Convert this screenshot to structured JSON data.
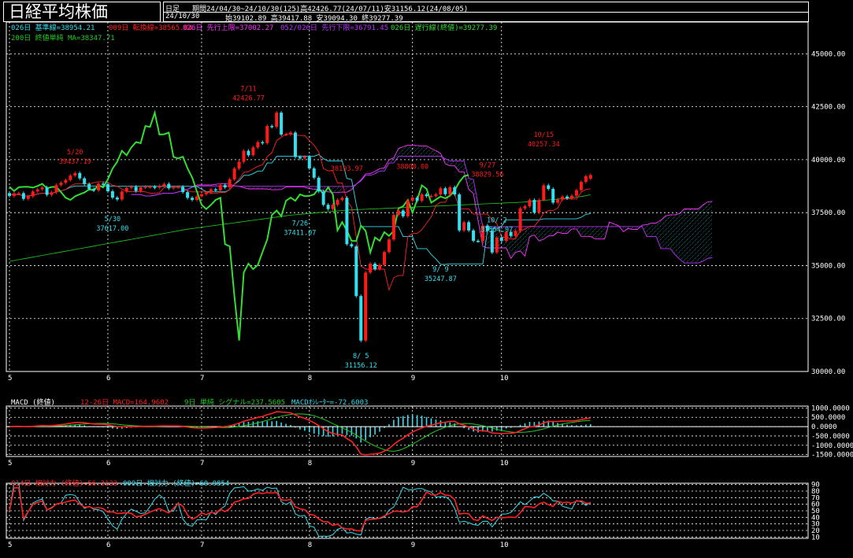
{
  "title": "日経平均株価",
  "header": {
    "period_type": "日足",
    "period_text": "期間24/04/30~24/10/30(125)高42426.77(24/07/11)安31156.12(24/08/05)",
    "date": "24/10/30",
    "ohlc": "始39102.89 高39417.88 安39094.30 終39277.39"
  },
  "colors": {
    "bg": "#000000",
    "grid": "#ffffff",
    "up": "#ff1a1a",
    "down": "#33e0f0",
    "ma200": "#22cc22",
    "chikou": "#33dd33",
    "kijun": "#33ddee",
    "tenkan": "#ff2222",
    "spanA": "#ff33ff",
    "spanB": "#bb33ff",
    "macd": "#ff2222",
    "signal": "#22cc22",
    "hist": "#33ddee",
    "rsi14": "#ff2222",
    "rsi9": "#33ddee"
  },
  "months": [
    "5",
    "6",
    "7",
    "8",
    "9",
    "10"
  ],
  "legend_main": {
    "kijun": "026日 基準線=38954.21",
    "tenkan": "009日 転換線=38565.04",
    "span_a": "026日 先行上限=37002.27",
    "span_b": "052/026日 先行下限=36791.45",
    "chikou": "026日 遅行線(終値)=39277.39",
    "ma200": "200日 終値単純 MA=38347.71"
  },
  "legend_macd": {
    "name": "MACD (終値)",
    "macd": "12-26日 MACD=164.9602",
    "signal": "9日 単純 シグナル=237.5605",
    "osc": "MACDｵｼﾚｰﾀｰ=-72.6003"
  },
  "legend_rsi": {
    "rsi14": "014日 相対力 (終値)=56.3133",
    "rsi9": "009日 相対力 (終値)=60.0854"
  },
  "annotations": [
    {
      "date_label": "5/20",
      "value_label": "39437.19",
      "color": "up"
    },
    {
      "date_label": "5/30",
      "value_label": "37617.00",
      "color": "down"
    },
    {
      "date_label": "7/11",
      "value_label": "42426.77",
      "color": "up"
    },
    {
      "date_label": "7/26",
      "value_label": "37411.07",
      "color": "down"
    },
    {
      "date_label": "8/ 5",
      "value_label": "31156.12",
      "color": "down"
    },
    {
      "date_label": "",
      "value_label": "38193.97",
      "color": "up"
    },
    {
      "date_label": "",
      "value_label": "38800.00",
      "color": "up"
    },
    {
      "date_label": "9/ 9",
      "value_label": "35247.87",
      "color": "down"
    },
    {
      "date_label": "9/27",
      "value_label": "38829.56",
      "color": "up"
    },
    {
      "date_label": "10/ 2",
      "value_label": "37564.97",
      "color": "down"
    },
    {
      "date_label": "10/15",
      "value_label": "40257.34",
      "color": "up"
    }
  ],
  "chart_data": [
    {
      "type": "candlestick",
      "title": "日経平均株価",
      "ylim": [
        30000,
        46500
      ],
      "yticks": [
        "45000.00",
        "42500.00",
        "40000.00",
        "37500.00",
        "35000.00",
        "32500.00",
        "30000.00"
      ],
      "ytick_values": [
        45000,
        42500,
        40000,
        37500,
        35000,
        32500,
        30000
      ],
      "x_months": [
        "5",
        "6",
        "7",
        "8",
        "9",
        "10"
      ],
      "bar_count": 125,
      "close": [
        38290,
        38410,
        38420,
        38150,
        38270,
        38500,
        38600,
        38690,
        38340,
        38460,
        38800,
        38910,
        39040,
        39250,
        39370,
        39120,
        38850,
        38620,
        38550,
        38870,
        38850,
        38510,
        38210,
        38120,
        38500,
        38670,
        38720,
        38520,
        38700,
        38720,
        38720,
        38680,
        38760,
        38860,
        38650,
        38710,
        38720,
        38470,
        38200,
        38100,
        38270,
        38370,
        38450,
        38600,
        38550,
        38800,
        38690,
        39070,
        39580,
        39900,
        40420,
        40210,
        40580,
        40830,
        40780,
        41590,
        41550,
        42220,
        41190,
        41200,
        41280,
        40130,
        40060,
        40140,
        39590,
        39150,
        38500,
        37870,
        37670,
        37870,
        38100,
        38200,
        36010,
        35910,
        33560,
        31460,
        34670,
        35090,
        34830,
        35030,
        35640,
        36230,
        37390,
        37600,
        37330,
        38060,
        38210,
        38060,
        38360,
        38280,
        38290,
        38360,
        38650,
        38370,
        38700,
        38360,
        36660,
        37050,
        36660,
        36170,
        36160,
        36890,
        36640,
        35620,
        36330,
        36170,
        36580,
        36400,
        36640,
        37700,
        37800,
        38100,
        37500,
        38100,
        38790,
        38620,
        37970,
        38120,
        38260,
        38180,
        38300,
        38560,
        38950,
        39220,
        39277
      ],
      "open": [
        38420,
        38290,
        38410,
        38420,
        38150,
        38270,
        38500,
        38600,
        38690,
        38340,
        38460,
        38800,
        38910,
        39040,
        39250,
        39370,
        39120,
        38850,
        38620,
        38550,
        38870,
        38850,
        38510,
        38210,
        38120,
        38500,
        38670,
        38720,
        38520,
        38700,
        38720,
        38720,
        38680,
        38760,
        38860,
        38650,
        38710,
        38720,
        38470,
        38200,
        38100,
        38270,
        38370,
        38450,
        38600,
        38550,
        38800,
        38690,
        39070,
        39580,
        39900,
        40420,
        40210,
        40580,
        40830,
        40780,
        41590,
        41550,
        42220,
        41190,
        41200,
        41280,
        40130,
        40060,
        40140,
        39590,
        39150,
        38500,
        37870,
        37670,
        37870,
        38100,
        38200,
        36010,
        35910,
        33560,
        31460,
        34670,
        35090,
        34830,
        35030,
        35640,
        36230,
        37390,
        37600,
        37330,
        38060,
        38210,
        38060,
        38360,
        38280,
        38290,
        38360,
        38650,
        38370,
        38700,
        38360,
        36660,
        37050,
        36660,
        36170,
        36160,
        36890,
        36640,
        35620,
        36330,
        36170,
        36580,
        36400,
        36640,
        37700,
        37800,
        38100,
        37500,
        38100,
        38790,
        38620,
        37970,
        38120,
        38260,
        38180,
        38300,
        38560,
        38950,
        39102
      ],
      "ma200": [
        35200,
        35240,
        35280,
        35320,
        35360,
        35400,
        35440,
        35480,
        35520,
        35560,
        35600,
        35640,
        35680,
        35720,
        35760,
        35800,
        35840,
        35880,
        35920,
        35960,
        36000,
        36040,
        36080,
        36120,
        36160,
        36200,
        36240,
        36280,
        36320,
        36360,
        36400,
        36440,
        36480,
        36520,
        36560,
        36600,
        36640,
        36680,
        36720,
        36750,
        36780,
        36810,
        36840,
        36870,
        36900,
        36930,
        36960,
        36990,
        37020,
        37050,
        37080,
        37110,
        37140,
        37170,
        37200,
        37230,
        37260,
        37290,
        37320,
        37350,
        37380,
        37400,
        37420,
        37440,
        37460,
        37480,
        37500,
        37520,
        37540,
        37560,
        37580,
        37600,
        37620,
        37630,
        37640,
        37650,
        37660,
        37670,
        37680,
        37690,
        37700,
        37710,
        37720,
        37730,
        37740,
        37750,
        37760,
        37770,
        37780,
        37790,
        37800,
        37810,
        37820,
        37830,
        37840,
        37850,
        37860,
        37870,
        37880,
        37890,
        37900,
        37910,
        37920,
        37930,
        37940,
        37950,
        37960,
        37970,
        37980,
        37990,
        38000,
        38020,
        38040,
        38060,
        38080,
        38100,
        38120,
        38140,
        38160,
        38180,
        38200,
        38230,
        38260,
        38300,
        38347
      ]
    },
    {
      "type": "macd",
      "title": "MACD (終値)",
      "ylim": [
        -1600,
        1100
      ],
      "yticks": [
        "1000.0000",
        "500.0000",
        "0.0000",
        "-500.0000",
        "-1000.0000",
        "-1500.0000"
      ],
      "ytick_values": [
        1000,
        500,
        0,
        -500,
        -1000,
        -1500
      ],
      "macd_last": 164.9602,
      "signal_last": 237.5605,
      "osc_last": -72.6003
    },
    {
      "type": "line",
      "title": "相対力",
      "ylim": [
        8,
        92
      ],
      "yticks": [
        "90",
        "80",
        "70",
        "60",
        "50",
        "40",
        "30",
        "20",
        "10"
      ],
      "ytick_values": [
        90,
        80,
        70,
        60,
        50,
        40,
        30,
        20,
        10
      ],
      "rsi14_last": 56.3133,
      "rsi9_last": 60.0854
    }
  ]
}
